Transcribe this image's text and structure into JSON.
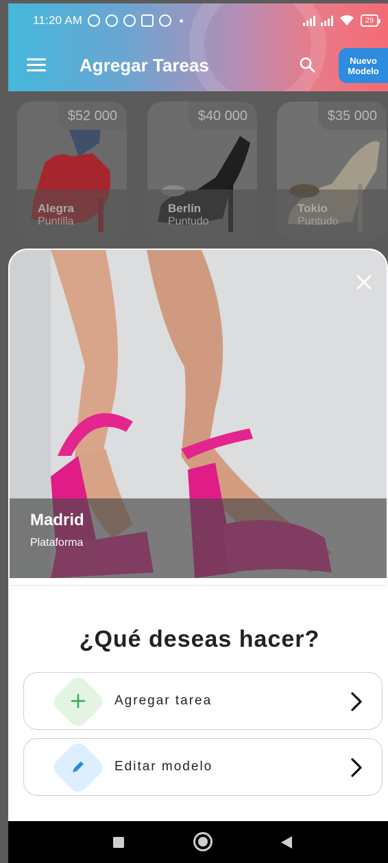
{
  "status_bar": {
    "time": "11:20 AM",
    "battery": "29"
  },
  "app_bar": {
    "title": "Agregar Tareas",
    "new_button_line1": "Nuevo",
    "new_button_line2": "Modelo",
    "icons": [
      "menu-icon",
      "search-icon"
    ]
  },
  "cards": [
    {
      "price": "$52 000",
      "name": "Alegra",
      "subtitle": "Puntilla"
    },
    {
      "price": "$40 000",
      "name": "Berlín",
      "subtitle": "Puntudo"
    },
    {
      "price": "$35 000",
      "name": "Tokio",
      "subtitle": "Puntudo"
    }
  ],
  "selected": {
    "name": "Madrid",
    "subtitle": "Plataforma"
  },
  "question": "¿Qué deseas hacer?",
  "actions": [
    {
      "label": "Agregar tarea",
      "icon": "plus-icon",
      "badge_color": "#e3f4e3",
      "icon_color": "#3aa655"
    },
    {
      "label": "Editar modelo",
      "icon": "pencil-icon",
      "badge_color": "#ddeefe",
      "icon_color": "#2f86dc"
    }
  ],
  "colors": {
    "accent": "#2d8be0"
  }
}
